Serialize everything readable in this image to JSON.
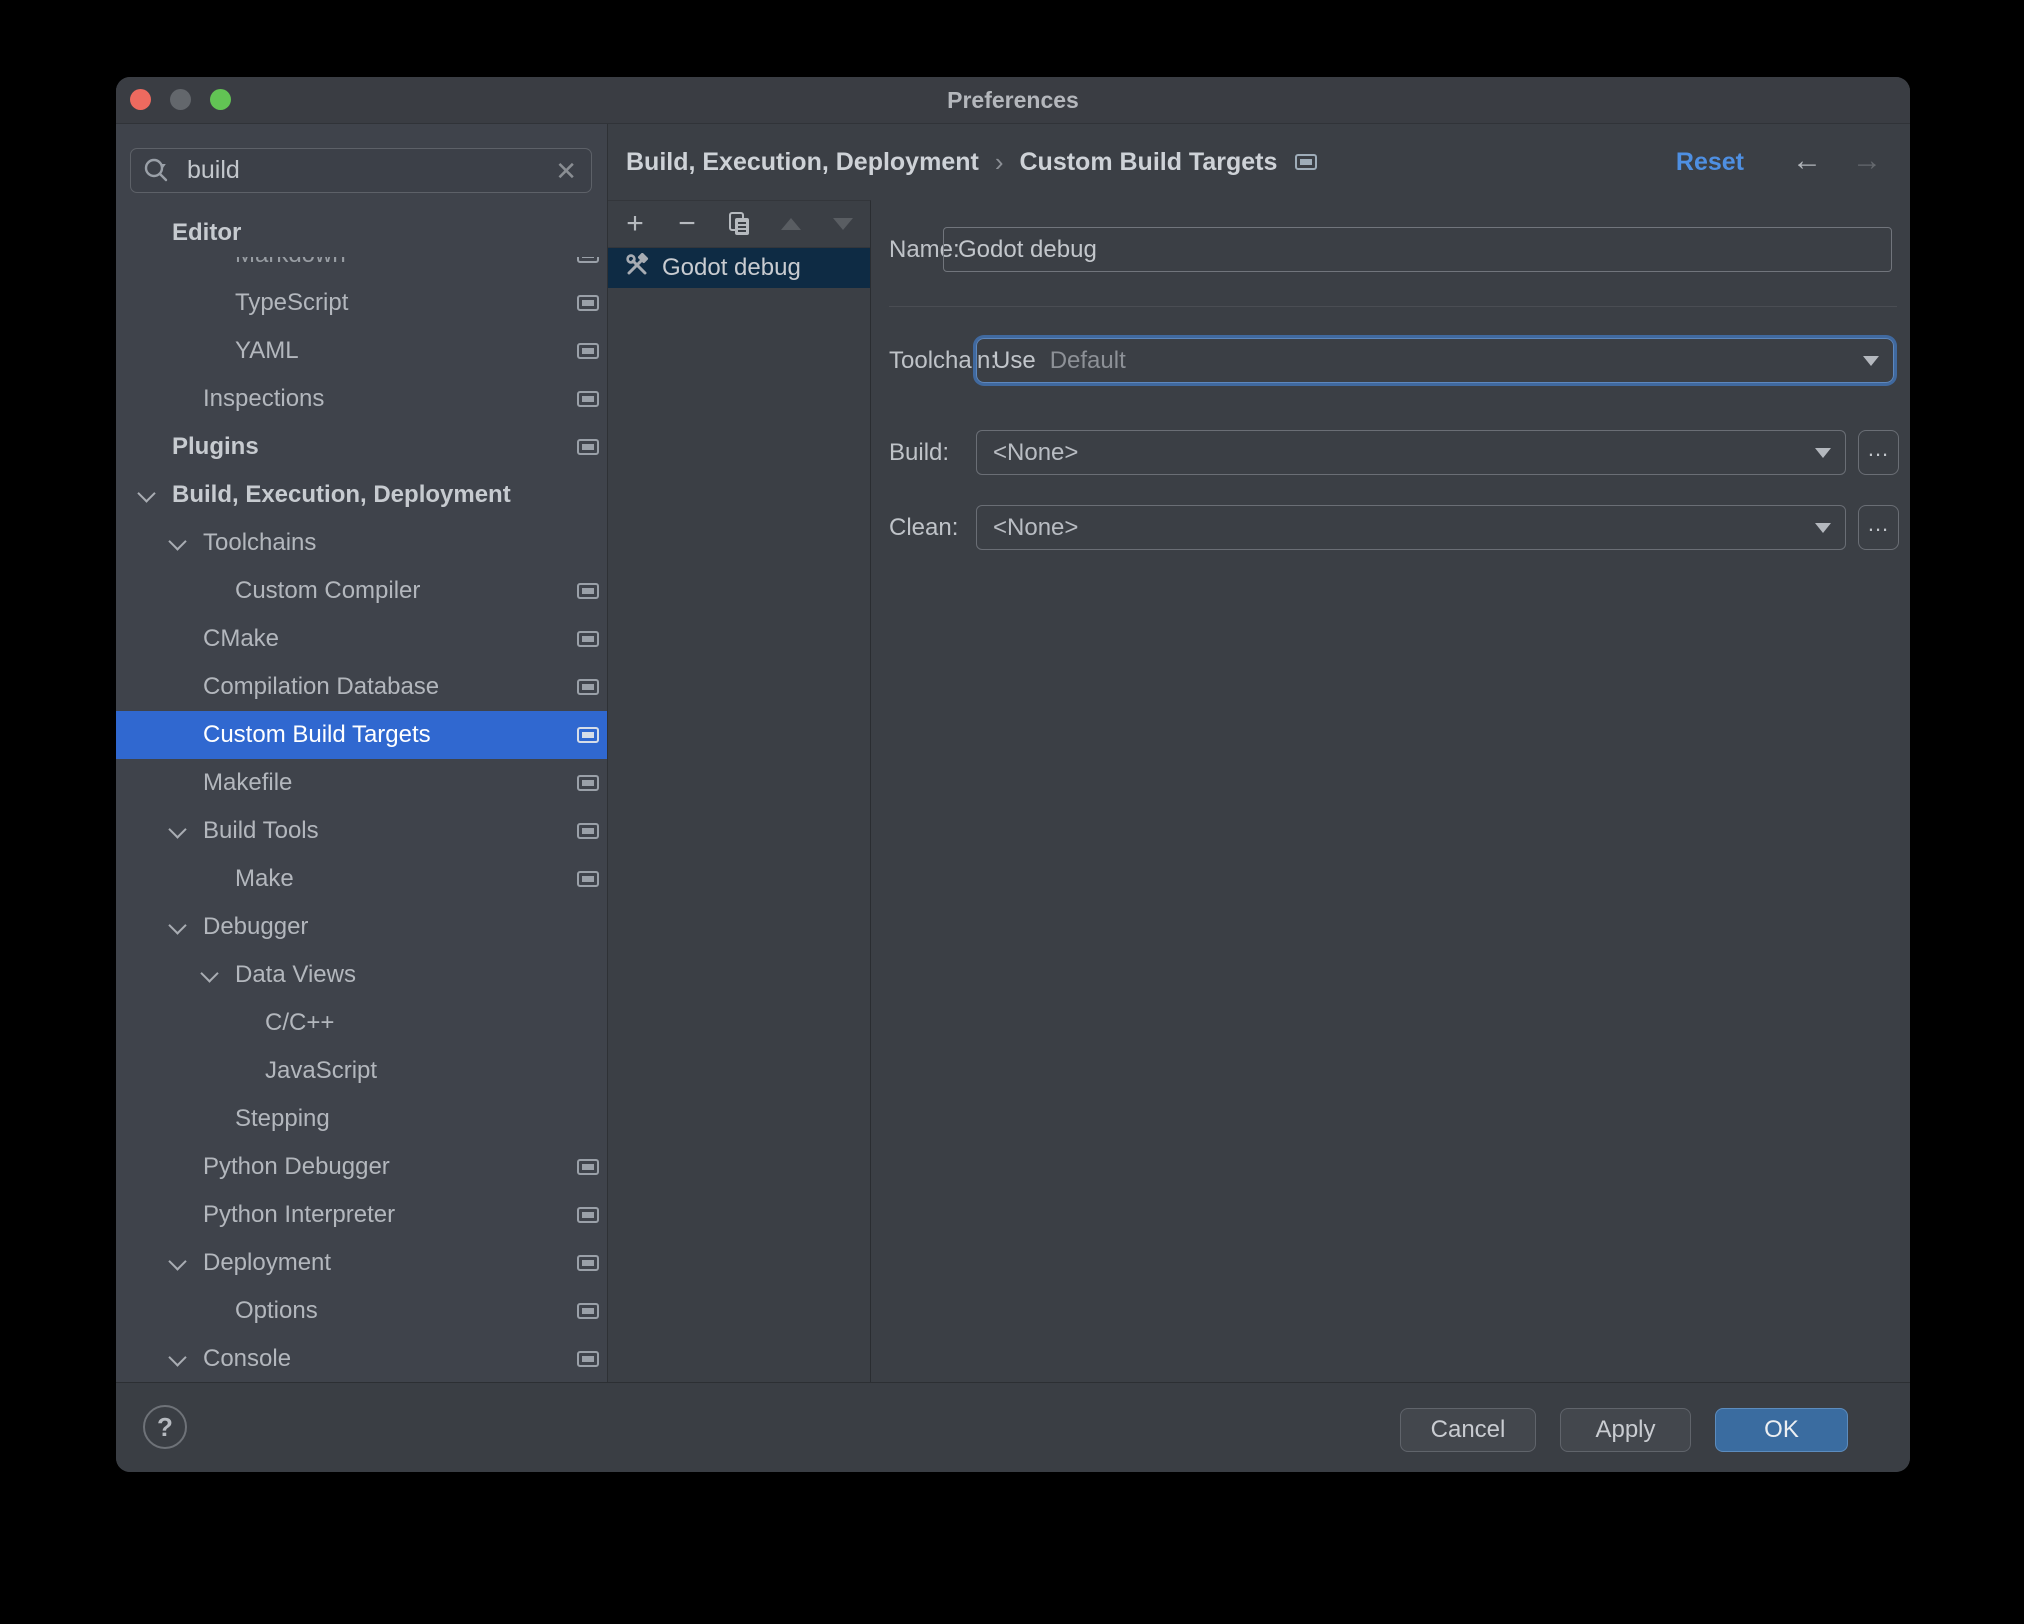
{
  "window": {
    "title": "Preferences"
  },
  "header": {
    "breadcrumb": [
      "Build, Execution, Deployment",
      "Custom Build Targets"
    ],
    "separator": "›",
    "reset_label": "Reset"
  },
  "sidebar": {
    "search": {
      "value": "build"
    },
    "tree": [
      {
        "label": "Editor",
        "level": 0,
        "bold": true,
        "sticky": true
      },
      {
        "label": "Markdown",
        "level": 2,
        "icon": true,
        "clipped": true
      },
      {
        "label": "TypeScript",
        "level": 2,
        "icon": true
      },
      {
        "label": "YAML",
        "level": 2,
        "icon": true
      },
      {
        "label": "Inspections",
        "level": 1,
        "icon": true
      },
      {
        "label": "Plugins",
        "level": 0,
        "bold": true,
        "icon": true
      },
      {
        "label": "Build, Execution, Deployment",
        "level": 0,
        "bold": true,
        "chevron": true
      },
      {
        "label": "Toolchains",
        "level": 1,
        "chevron": true
      },
      {
        "label": "Custom Compiler",
        "level": 2,
        "icon": true
      },
      {
        "label": "CMake",
        "level": 1,
        "icon": true
      },
      {
        "label": "Compilation Database",
        "level": 1,
        "icon": true
      },
      {
        "label": "Custom Build Targets",
        "level": 1,
        "icon": true,
        "selected": true
      },
      {
        "label": "Makefile",
        "level": 1,
        "icon": true
      },
      {
        "label": "Build Tools",
        "level": 1,
        "chevron": true,
        "icon": true
      },
      {
        "label": "Make",
        "level": 2,
        "icon": true
      },
      {
        "label": "Debugger",
        "level": 1,
        "chevron": true
      },
      {
        "label": "Data Views",
        "level": 2,
        "chevron": true
      },
      {
        "label": "C/C++",
        "level": 3
      },
      {
        "label": "JavaScript",
        "level": 3
      },
      {
        "label": "Stepping",
        "level": 2
      },
      {
        "label": "Python Debugger",
        "level": 1,
        "icon": true
      },
      {
        "label": "Python Interpreter",
        "level": 1,
        "icon": true
      },
      {
        "label": "Deployment",
        "level": 1,
        "chevron": true,
        "icon": true
      },
      {
        "label": "Options",
        "level": 2,
        "icon": true
      },
      {
        "label": "Console",
        "level": 1,
        "chevron": true,
        "icon": true
      }
    ]
  },
  "targets_panel": {
    "toolbar": [
      "add",
      "remove",
      "duplicate",
      "move-up",
      "move-down"
    ],
    "items": [
      {
        "label": "Godot debug",
        "selected": true
      }
    ]
  },
  "form": {
    "name_label": "Name:",
    "name_value": "Godot debug",
    "toolchain_label": "Toolchain:",
    "toolchain_prefix": "Use",
    "toolchain_value": "Default",
    "build_label": "Build:",
    "build_value": "<None>",
    "clean_label": "Clean:",
    "clean_value": "<None>",
    "browse_label": "..."
  },
  "footer": {
    "help_label": "?",
    "cancel_label": "Cancel",
    "apply_label": "Apply",
    "ok_label": "OK"
  },
  "colors": {
    "selection_blue": "#3068d0",
    "inactive_selection_navy": "#0e2b44",
    "link_blue": "#4e8fe2",
    "ok_button_blue": "#3a6ca0",
    "traffic_red": "#ed6a5f",
    "traffic_gray": "#63676c",
    "traffic_green": "#62c454"
  }
}
